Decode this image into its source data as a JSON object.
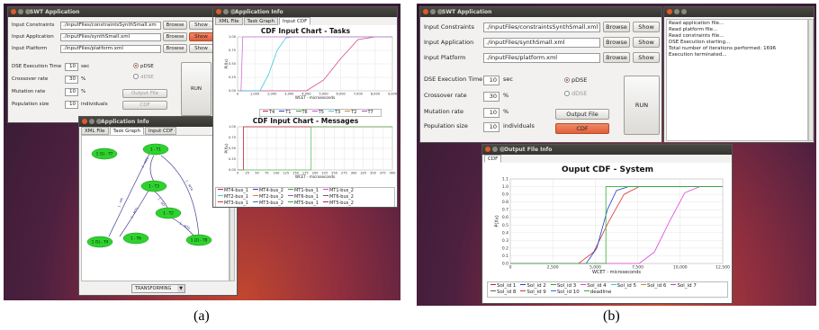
{
  "captions": {
    "a": "(a)",
    "b": "(b)"
  },
  "screens": [
    {
      "main": {
        "title": "SWT Application",
        "fields": [
          {
            "label": "Input Constraints",
            "value": "./inputFiles/constraintsSynthSmall.xm"
          },
          {
            "label": "Input Application",
            "value": "./inputFiles/synthSmall.xml"
          },
          {
            "label": "Input Platform",
            "value": "./inputFiles/platform.xml"
          }
        ],
        "browse": "Browse",
        "show": "Show",
        "params": [
          {
            "label": "DSE Execution Time",
            "value": "10",
            "unit": "sec"
          },
          {
            "label": "Crossover rate",
            "value": "30",
            "unit": "%"
          },
          {
            "label": "Mutation rate",
            "value": "10",
            "unit": "%"
          },
          {
            "label": "Population size",
            "value": "10",
            "unit": "individuals"
          }
        ],
        "pdse": "pDSE",
        "ddse": "dDSE",
        "output": "Output File",
        "cdf": "CDF",
        "run": "RUN"
      },
      "info_graph": {
        "title": "Application Info",
        "tabs": [
          "XML File",
          "Task Graph",
          "Input CDF"
        ],
        "nodes": [
          "1 (1) - T7",
          "1 - T1",
          "1 - T3",
          "1 - T2",
          "1 (5) - T4",
          "1 - T6",
          "1 (2) - T8"
        ],
        "edges": [
          "1 - M6",
          "1 - MT2",
          "1 - MT4",
          "1 - MT3",
          "1 - M7",
          "1 - MT5"
        ],
        "select": "TRANSFORMING"
      },
      "info_cdf": {
        "title": "Application Info",
        "tabs": [
          "XML File",
          "Task Graph",
          "Input CDF"
        ],
        "chart1_title": "CDF Input Chart - Tasks",
        "chart2_title": "CDF Input Chart - Messages",
        "legend1": [
          "T4",
          "T1",
          "T6",
          "T5",
          "T3",
          "T2",
          "T7"
        ],
        "legend2": [
          "MT4-bus_1",
          "MT4-bus_2",
          "MT1-bus_1",
          "MT1-bus_2",
          "MT2-bus_1",
          "MT2-bus_2",
          "MT6-bus_1",
          "MT6-bus_2",
          "MT3-bus_1",
          "MT3-bus_2",
          "MT5-bus_1",
          "MT5-bus_2"
        ]
      }
    },
    {
      "main": {
        "title": "SWT Application",
        "fields": [
          {
            "label": "Input Constraints",
            "value": "./inputFiles/constraintsSynthSmall.xml"
          },
          {
            "label": "Input Application",
            "value": "./inputFiles/synthSmall.xml"
          },
          {
            "label": "Input Platform",
            "value": "./inputFiles/platform.xml"
          }
        ],
        "browse": "Browse",
        "show": "Show",
        "params": [
          {
            "label": "DSE Execution Time",
            "value": "10",
            "unit": "sec"
          },
          {
            "label": "Crossover rate",
            "value": "30",
            "unit": "%"
          },
          {
            "label": "Mutation rate",
            "value": "10",
            "unit": "%"
          },
          {
            "label": "Population size",
            "value": "10",
            "unit": "individuals"
          }
        ],
        "pdse": "pDSE",
        "ddse": "dDSE",
        "output": "Output File",
        "cdf": "CDF",
        "run": "RUN"
      },
      "log": [
        "Read application file...",
        "Read platform file...",
        "Read constraints file...",
        "DSE Execution starting...",
        "Total number of iterations performed: 1696",
        "Execution terminated..."
      ],
      "output": {
        "title": "Output File Info",
        "tab": "CDF",
        "chart_title": "Ouput CDF - System",
        "legend": [
          "Sol_id 1",
          "Sol_id 2",
          "Sol_id 3",
          "Sol_id 4",
          "Sol_id 5",
          "Sol_id 6",
          "Sol_id 7",
          "Sol_id 8",
          "Sol_id 9",
          "Sol_id 10",
          "deadline"
        ]
      }
    }
  ],
  "chart_data": [
    {
      "type": "line",
      "title": "CDF Input Chart - Tasks",
      "xlabel": "WCET - microseconds",
      "ylabel": "P(Xx)",
      "xlim": [
        0,
        9000
      ],
      "ylim": [
        0,
        1.0
      ],
      "x_ticks": [
        "0",
        "1,000",
        "2,000",
        "3,000",
        "4,000",
        "5,000",
        "6,000",
        "7,000",
        "8,000",
        "9,000"
      ],
      "y_ticks": [
        "0.00",
        "0.25",
        "0.50",
        "0.75",
        "1.00"
      ],
      "series": [
        {
          "name": "T4",
          "color": "#d04a8a",
          "x": [
            4000,
            5000,
            6000,
            7000,
            8000
          ],
          "y": [
            0,
            0.2,
            0.6,
            0.95,
            1.0
          ]
        },
        {
          "name": "T5",
          "color": "#3ac8d8",
          "x": [
            1300,
            1800,
            2300,
            2800,
            3200
          ],
          "y": [
            0,
            0.3,
            0.75,
            0.98,
            1.0
          ]
        },
        {
          "name": "T6",
          "color": "#d070d0",
          "x": [
            200,
            300
          ],
          "y": [
            0,
            1.0
          ]
        }
      ]
    },
    {
      "type": "line",
      "title": "CDF Input Chart - Messages",
      "xlabel": "WCET - microseconds",
      "ylabel": "P(Xx)",
      "xlim": [
        0,
        400
      ],
      "ylim": [
        0,
        1.0
      ],
      "x_ticks": [
        "0",
        "25",
        "50",
        "75",
        "100",
        "125",
        "150",
        "175",
        "200",
        "225",
        "250",
        "275",
        "300",
        "325",
        "350",
        "375",
        "400"
      ],
      "y_ticks": [
        "0.00",
        "0.25",
        "0.50",
        "0.75",
        "1.00"
      ],
      "series": [
        {
          "name": "MT4-bus_1",
          "color": "#c0203a",
          "x": [
            15,
            15
          ],
          "y": [
            0,
            1.0
          ]
        },
        {
          "name": "MT1-bus_1",
          "color": "#5ac060",
          "x": [
            190,
            190
          ],
          "y": [
            0,
            1.0
          ]
        }
      ]
    },
    {
      "type": "line",
      "title": "Ouput CDF - System",
      "xlabel": "WCET - microseconds",
      "ylabel": "P(Xx)",
      "xlim": [
        0,
        14000
      ],
      "ylim": [
        0,
        1.1
      ],
      "x_ticks": [
        "0",
        "2,500",
        "5,000",
        "7,500",
        "10,000",
        "12,500"
      ],
      "y_ticks": [
        "0.0",
        "0.1",
        "0.2",
        "0.3",
        "0.4",
        "0.5",
        "0.6",
        "0.7",
        "0.8",
        "0.9",
        "1.0",
        "1.1"
      ],
      "series": [
        {
          "name": "Sol_id 1",
          "color": "#e03030",
          "x": [
            4500,
            5500,
            6500,
            7500,
            8500
          ],
          "y": [
            0,
            0.15,
            0.55,
            0.9,
            1.0
          ]
        },
        {
          "name": "Sol_id 2",
          "color": "#2040d0",
          "x": [
            5000,
            5700,
            6400,
            7000,
            7800
          ],
          "y": [
            0,
            0.2,
            0.7,
            0.95,
            1.0
          ]
        },
        {
          "name": "Sol_id 9",
          "color": "#e040e0",
          "x": [
            8500,
            9500,
            10500,
            11500,
            12500
          ],
          "y": [
            0,
            0.15,
            0.55,
            0.92,
            1.0
          ]
        },
        {
          "name": "deadline",
          "color": "#30b030",
          "x": [
            6300,
            6300
          ],
          "y": [
            0,
            1.0
          ]
        }
      ]
    }
  ]
}
